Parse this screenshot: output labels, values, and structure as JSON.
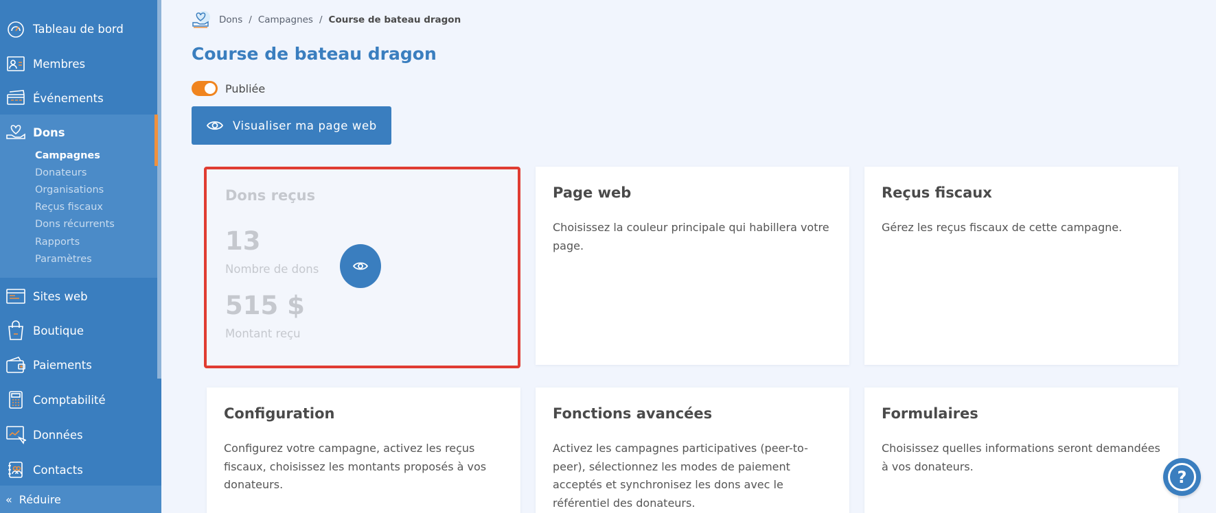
{
  "sidebar": {
    "items": [
      {
        "label": "Tableau de bord",
        "icon": "dashboard-icon"
      },
      {
        "label": "Membres",
        "icon": "members-icon"
      },
      {
        "label": "Événements",
        "icon": "events-icon"
      },
      {
        "label": "Dons",
        "icon": "donations-icon"
      },
      {
        "label": "Sites web",
        "icon": "websites-icon"
      },
      {
        "label": "Boutique",
        "icon": "shop-icon"
      },
      {
        "label": "Paiements",
        "icon": "payments-icon"
      },
      {
        "label": "Comptabilité",
        "icon": "accounting-icon"
      },
      {
        "label": "Données",
        "icon": "data-icon"
      },
      {
        "label": "Contacts",
        "icon": "contacts-icon"
      }
    ],
    "dons_sub": [
      "Campagnes",
      "Donateurs",
      "Organisations",
      "Reçus fiscaux",
      "Dons récurrents",
      "Rapports",
      "Paramètres"
    ],
    "collapse_label": "Réduire"
  },
  "breadcrumb": {
    "items": [
      "Dons",
      "Campagnes"
    ],
    "current": "Course de bateau dragon",
    "separator": "/"
  },
  "page": {
    "title": "Course de bateau dragon",
    "toggle_label": "Publiée",
    "view_button": "Visualiser ma page web"
  },
  "cards": {
    "stats": {
      "title": "Dons reçus",
      "count_value": "13",
      "count_label": "Nombre de dons",
      "amount_value": "515 $",
      "amount_label": "Montant reçu"
    },
    "web": {
      "title": "Page web",
      "desc": "Choisissez la couleur principale qui habillera votre page."
    },
    "receipts": {
      "title": "Reçus fiscaux",
      "desc": "Gérez les reçus fiscaux de cette campagne."
    },
    "config": {
      "title": "Configuration",
      "desc": "Configurez votre campagne, activez les reçus fiscaux, choisissez les montants proposés à vos donateurs."
    },
    "advanced": {
      "title": "Fonctions avancées",
      "desc": "Activez les campagnes participatives (peer-to-peer), sélectionnez les modes de paiement acceptés et synchronisez les dons avec le référentiel des donateurs."
    },
    "forms": {
      "title": "Formulaires",
      "desc": "Choisissez quelles informations seront demandées à vos donateurs."
    }
  },
  "help": {
    "label": "?"
  },
  "colors": {
    "primary": "#3a7ebf",
    "accent": "#f0841e",
    "highlight": "#e03c32"
  }
}
